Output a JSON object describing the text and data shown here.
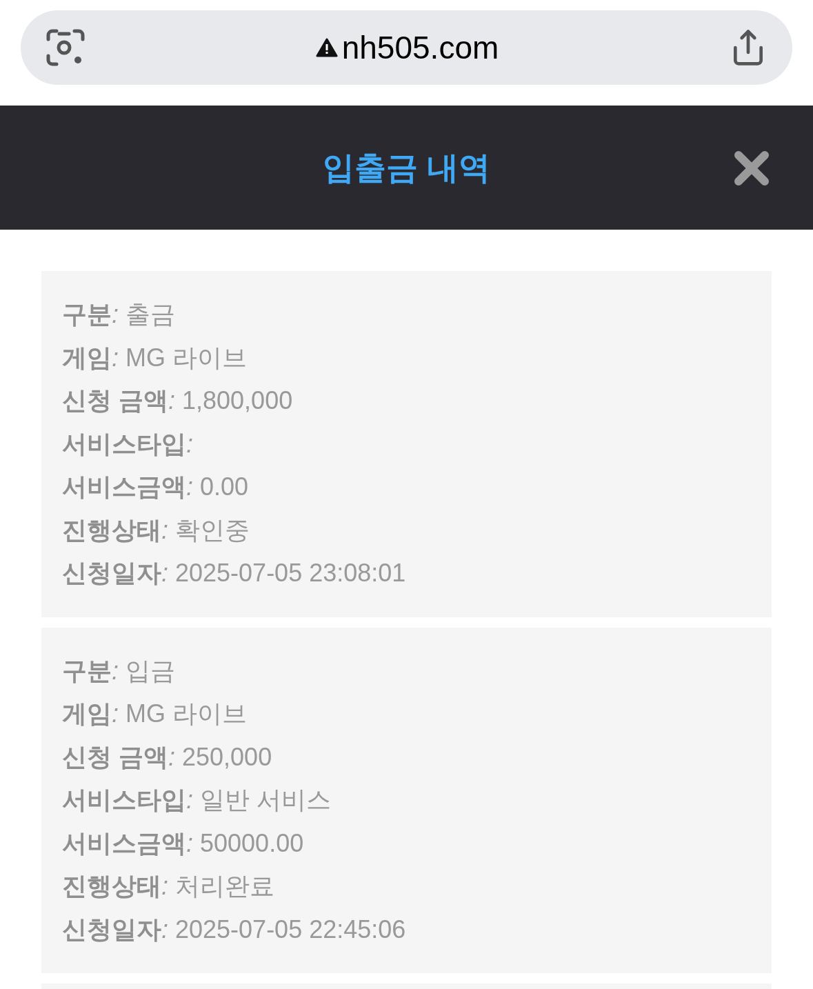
{
  "address_bar": {
    "url": "nh505.com"
  },
  "header": {
    "title": "입출금 내역"
  },
  "records": [
    {
      "kind": "full",
      "fields": [
        {
          "label": "구분",
          "value": "*:* 출금"
        },
        {
          "label": "게임",
          "value": "*:* MG 라이브"
        },
        {
          "label": "신청 금액",
          "value": "*:* 1,800,000"
        },
        {
          "label": "서비스타입",
          "value": "*:*"
        },
        {
          "label": "서비스금액",
          "value": "*:* 0.00"
        },
        {
          "label": "진행상태",
          "value": "*:* 확인중"
        },
        {
          "label": "신청일자",
          "value": "*:* 2025-07-05 23:08:01"
        }
      ]
    },
    {
      "kind": "full",
      "fields": [
        {
          "label": "구분",
          "value": "*:* 입금"
        },
        {
          "label": "게임",
          "value": "*:* MG 라이브"
        },
        {
          "label": "신청 금액",
          "value": "*:* 250,000"
        },
        {
          "label": "서비스타입",
          "value": "*:* 일반 서비스"
        },
        {
          "label": "서비스금액",
          "value": "*:* 50000.00"
        },
        {
          "label": "진행상태",
          "value": "*:* 처리완료"
        },
        {
          "label": "신청일자",
          "value": "*:* 2025-07-05 22:45:06"
        }
      ]
    },
    {
      "kind": "cut_off"
    }
  ]
}
